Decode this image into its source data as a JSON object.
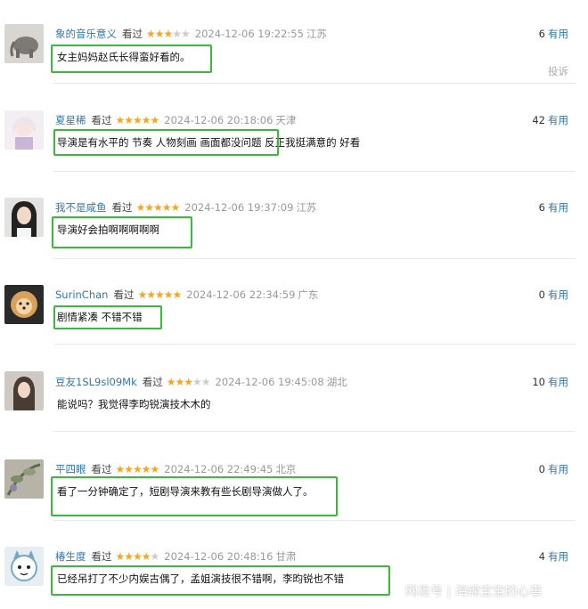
{
  "reviews": [
    {
      "user": "象的音乐意义",
      "watched": "看过",
      "rating": 3,
      "time": "2024-12-06 19:22:55",
      "location": "江苏",
      "useful_count": "6",
      "useful_label": "有用",
      "comment": "女主妈妈赵氏长得蛮好看的。",
      "report": "投诉",
      "avatar": "elephant"
    },
    {
      "user": "夏星稀",
      "watched": "看过",
      "rating": 5,
      "time": "2024-12-06 20:18:06",
      "location": "天津",
      "useful_count": "42",
      "useful_label": "有用",
      "comment": "导演是有水平的 节奏 人物刻画 画面都没问题 反正我挺满意的 好看",
      "avatar": "anime-girl"
    },
    {
      "user": "我不是咸鱼",
      "watched": "看过",
      "rating": 5,
      "time": "2024-12-06 19:37:09",
      "location": "江苏",
      "useful_count": "6",
      "useful_label": "有用",
      "comment": "导演好会拍啊啊啊啊啊",
      "avatar": "girl-dark-hair"
    },
    {
      "user": "SurinChan",
      "watched": "看过",
      "rating": 5,
      "time": "2024-12-06 22:34:59",
      "location": "广东",
      "useful_count": "0",
      "useful_label": "有用",
      "comment": "剧情紧凑 不错不错",
      "avatar": "pomeranian"
    },
    {
      "user": "豆友1SL9sl09Mk",
      "watched": "看过",
      "rating": 3,
      "time": "2024-12-06 19:45:08",
      "location": "湖北",
      "useful_count": "10",
      "useful_label": "有用",
      "comment": "能说吗？我觉得李昀锐演技木木的",
      "avatar": "girl-portrait"
    },
    {
      "user": "平四眼",
      "watched": "看过",
      "rating": 5,
      "time": "2024-12-06 22:49:45",
      "location": "北京",
      "useful_count": "0",
      "useful_label": "有用",
      "comment": "看了一分钟确定了，短剧导演来教有些长剧导演做人了。",
      "avatar": "plant-art"
    },
    {
      "user": "椿生度",
      "watched": "看过",
      "rating": 4,
      "time": "2024-12-06 20:48:16",
      "location": "甘肃",
      "useful_count": "4",
      "useful_label": "有用",
      "comment": "已经吊打了不少内娱古偶了，孟姐演技很不错啊，李昀锐也不错",
      "avatar": "cartoon-cat"
    }
  ],
  "watermark": "网易号 | 海绵宝宝的心事"
}
